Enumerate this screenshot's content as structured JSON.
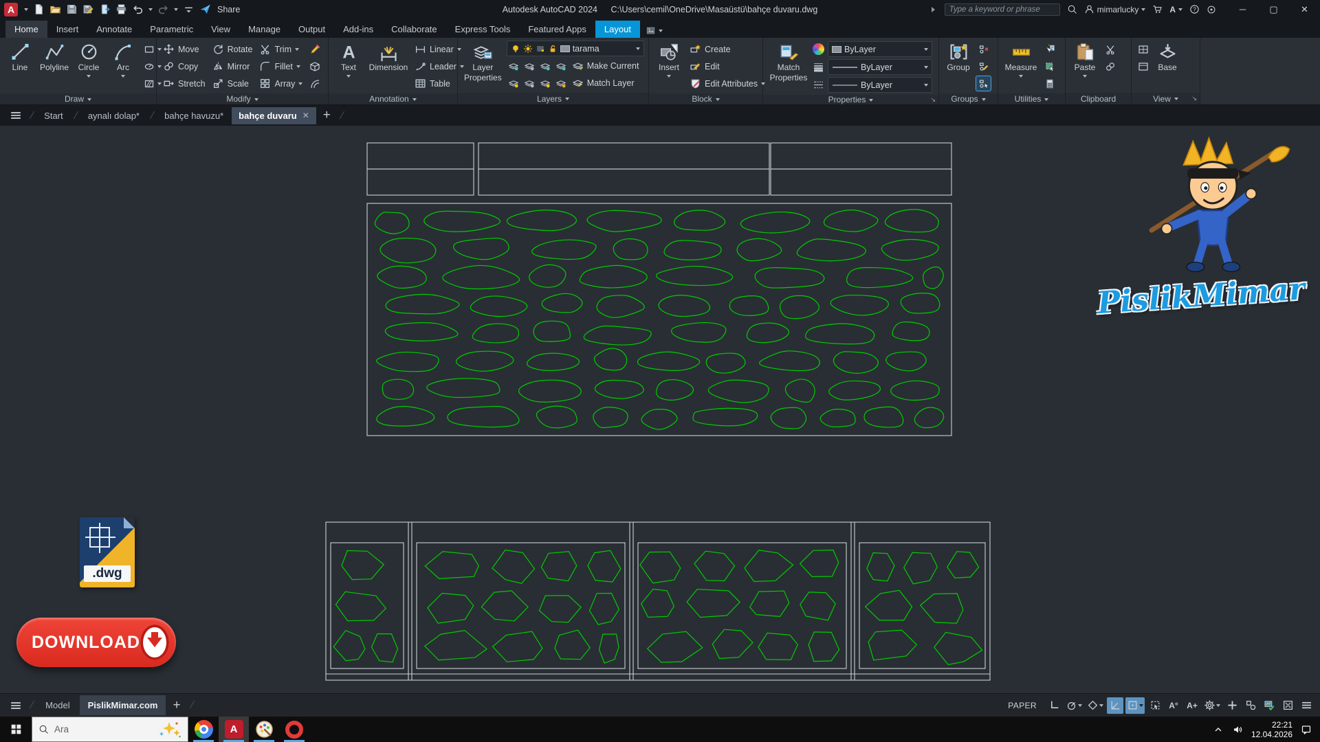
{
  "titlebar": {
    "title": "Autodesk AutoCAD 2024",
    "file_path": "C:\\Users\\cemil\\OneDrive\\Masaüstü\\bahçe duvaru.dwg",
    "share": "Share",
    "search_placeholder": "Type a keyword or phrase",
    "account": "mimarlucky",
    "minimize": "─",
    "maximize": "▢",
    "close": "✕"
  },
  "ribbon_tabs": {
    "items": [
      "Home",
      "Insert",
      "Annotate",
      "Parametric",
      "View",
      "Manage",
      "Output",
      "Add-ins",
      "Collaborate",
      "Express Tools",
      "Featured Apps",
      "Layout"
    ],
    "active": "Home",
    "highlighted": "Layout"
  },
  "ribbon": {
    "draw": {
      "label": "Draw",
      "line": "Line",
      "polyline": "Polyline",
      "circle": "Circle",
      "arc": "Arc"
    },
    "modify": {
      "label": "Modify",
      "move": "Move",
      "copy": "Copy",
      "stretch": "Stretch",
      "rotate": "Rotate",
      "mirror": "Mirror",
      "scale": "Scale",
      "trim": "Trim",
      "fillet": "Fillet",
      "array": "Array"
    },
    "annotation": {
      "label": "Annotation",
      "text": "Text",
      "dimension": "Dimension",
      "linear": "Linear",
      "leader": "Leader",
      "table": "Table"
    },
    "layers": {
      "label": "Layers",
      "layer_properties_1": "Layer",
      "layer_properties_2": "Properties",
      "current_layer": "tarama",
      "make_current": "Make Current",
      "match_layer": "Match Layer"
    },
    "block": {
      "label": "Block",
      "insert": "Insert",
      "create": "Create",
      "edit": "Edit",
      "edit_attributes": "Edit Attributes"
    },
    "properties": {
      "label": "Properties",
      "match_1": "Match",
      "match_2": "Properties",
      "color": "ByLayer",
      "lineweight": "ByLayer",
      "linetype": "ByLayer"
    },
    "groups": {
      "label": "Groups",
      "group": "Group"
    },
    "utilities": {
      "label": "Utilities",
      "measure": "Measure"
    },
    "clipboard": {
      "label": "Clipboard",
      "paste": "Paste"
    },
    "view": {
      "label": "View",
      "base": "Base"
    }
  },
  "file_tabs": {
    "items": [
      "Start",
      "aynalı dolap*",
      "bahçe havuzu*",
      "bahçe duvaru"
    ],
    "active": "bahçe duvaru",
    "close_glyph": "✕",
    "plus_glyph": "+"
  },
  "canvas": {
    "logo_text": "PislikMimar",
    "dwg_label": ".dwg",
    "download_label": "DOWNLOAD"
  },
  "statusbar": {
    "space": "PAPER",
    "tabs": [
      "Model",
      "PislikMimar.com"
    ],
    "active_tab": "PislikMimar.com",
    "plus_glyph": "+",
    "annotation_visibility": "A°",
    "annotation_scale": "A+"
  },
  "taskbar": {
    "search_placeholder": "Ara",
    "time": "22:21",
    "date": "12.04.2026"
  },
  "colors": {
    "accent_blue": "#0696d7",
    "stone_green": "#00cc00",
    "download_red": "#d92a20",
    "logo_blue": "#1b9be0"
  }
}
